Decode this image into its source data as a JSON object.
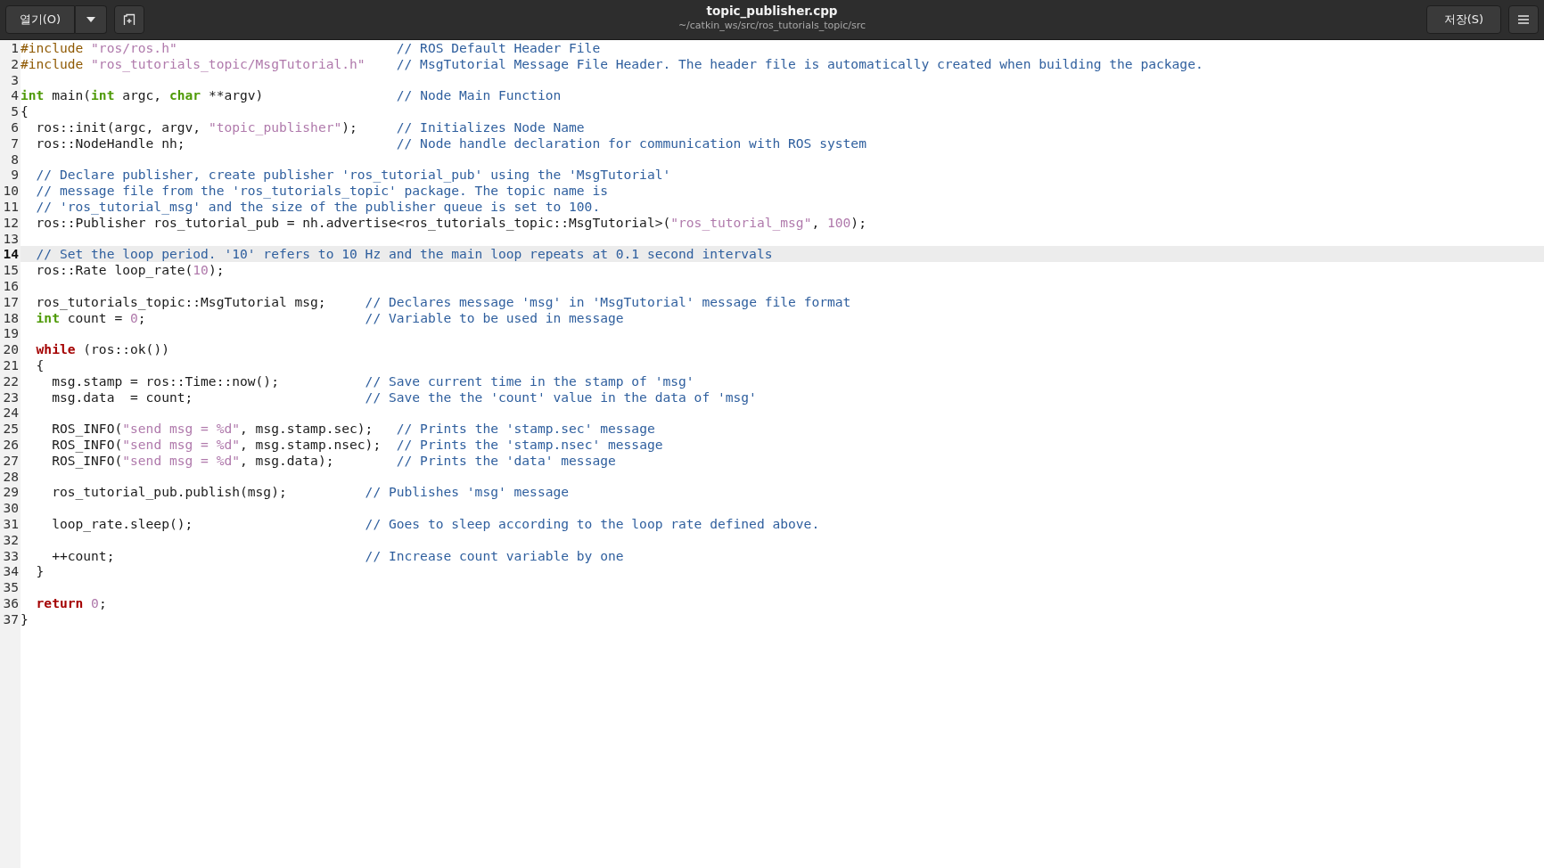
{
  "header": {
    "open_button": "열기(O)",
    "title": "topic_publisher.cpp",
    "subtitle": "~/catkin_ws/src/ros_tutorials_topic/src",
    "save_button": "저장(S)"
  },
  "editor": {
    "lines": [
      {
        "number": "1",
        "current": false,
        "tokens": [
          {
            "kind": "preproc",
            "text": "#include "
          },
          {
            "kind": "string",
            "text": "\"ros/ros.h\""
          },
          {
            "kind": "comment",
            "text": "                            // ROS Default Header File"
          }
        ]
      },
      {
        "number": "2",
        "current": false,
        "tokens": [
          {
            "kind": "preproc",
            "text": "#include "
          },
          {
            "kind": "string",
            "text": "\"ros_tutorials_topic/MsgTutorial.h\""
          },
          {
            "kind": "comment",
            "text": "    // MsgTutorial Message File Header. The header file is automatically created when building the package."
          }
        ]
      },
      {
        "number": "3",
        "current": false
      },
      {
        "number": "4",
        "current": false,
        "tokens": [
          {
            "kind": "type",
            "text": "int"
          },
          {
            "kind": "plain",
            "text": " main("
          },
          {
            "kind": "type",
            "text": "int"
          },
          {
            "kind": "plain",
            "text": " argc, "
          },
          {
            "kind": "type",
            "text": "char"
          },
          {
            "kind": "plain",
            "text": " **argv)"
          },
          {
            "kind": "comment",
            "text": "                 // Node Main Function"
          }
        ]
      },
      {
        "number": "5",
        "current": false,
        "tokens": [
          {
            "kind": "plain",
            "text": "{"
          }
        ]
      },
      {
        "number": "6",
        "current": false,
        "tokens": [
          {
            "kind": "plain",
            "text": "  ros::init(argc, argv, "
          },
          {
            "kind": "string",
            "text": "\"topic_publisher\""
          },
          {
            "kind": "plain",
            "text": ");"
          },
          {
            "kind": "comment",
            "text": "     // Initializes Node Name"
          }
        ]
      },
      {
        "number": "7",
        "current": false,
        "tokens": [
          {
            "kind": "plain",
            "text": "  ros::NodeHandle nh;"
          },
          {
            "kind": "comment",
            "text": "                           // Node handle declaration for communication with ROS system"
          }
        ]
      },
      {
        "number": "8",
        "current": false
      },
      {
        "number": "9",
        "current": false,
        "tokens": [
          {
            "kind": "comment",
            "text": "  // Declare publisher, create publisher 'ros_tutorial_pub' using the 'MsgTutorial'"
          }
        ]
      },
      {
        "number": "10",
        "current": false,
        "tokens": [
          {
            "kind": "comment",
            "text": "  // message file from the 'ros_tutorials_topic' package. The topic name is"
          }
        ]
      },
      {
        "number": "11",
        "current": false,
        "tokens": [
          {
            "kind": "comment",
            "text": "  // 'ros_tutorial_msg' and the size of the publisher queue is set to 100."
          }
        ]
      },
      {
        "number": "12",
        "current": false,
        "tokens": [
          {
            "kind": "plain",
            "text": "  ros::Publisher ros_tutorial_pub = nh.advertise<ros_tutorials_topic::MsgTutorial>("
          },
          {
            "kind": "string",
            "text": "\"ros_tutorial_msg\""
          },
          {
            "kind": "plain",
            "text": ", "
          },
          {
            "kind": "number",
            "text": "100"
          },
          {
            "kind": "plain",
            "text": ");"
          }
        ]
      },
      {
        "number": "13",
        "current": false
      },
      {
        "number": "14",
        "current": true,
        "tokens": [
          {
            "kind": "comment",
            "text": "  // Set the loop period. '10' refers to 10 Hz and the main loop repeats at 0.1 second intervals"
          }
        ]
      },
      {
        "number": "15",
        "current": false,
        "tokens": [
          {
            "kind": "plain",
            "text": "  ros::Rate loop_rate("
          },
          {
            "kind": "number",
            "text": "10"
          },
          {
            "kind": "plain",
            "text": ");"
          }
        ]
      },
      {
        "number": "16",
        "current": false
      },
      {
        "number": "17",
        "current": false,
        "tokens": [
          {
            "kind": "plain",
            "text": "  ros_tutorials_topic::MsgTutorial msg;"
          },
          {
            "kind": "comment",
            "text": "     // Declares message 'msg' in 'MsgTutorial' message file format"
          }
        ]
      },
      {
        "number": "18",
        "current": false,
        "tokens": [
          {
            "kind": "type",
            "text": "  int"
          },
          {
            "kind": "plain",
            "text": " count = "
          },
          {
            "kind": "number",
            "text": "0"
          },
          {
            "kind": "plain",
            "text": ";"
          },
          {
            "kind": "comment",
            "text": "                            // Variable to be used in message"
          }
        ]
      },
      {
        "number": "19",
        "current": false
      },
      {
        "number": "20",
        "current": false,
        "tokens": [
          {
            "kind": "keyword",
            "text": "  while"
          },
          {
            "kind": "plain",
            "text": " (ros::ok())"
          }
        ]
      },
      {
        "number": "21",
        "current": false,
        "tokens": [
          {
            "kind": "plain",
            "text": "  {"
          }
        ]
      },
      {
        "number": "22",
        "current": false,
        "tokens": [
          {
            "kind": "plain",
            "text": "    msg.stamp = ros::Time::now();"
          },
          {
            "kind": "comment",
            "text": "           // Save current time in the stamp of 'msg'"
          }
        ]
      },
      {
        "number": "23",
        "current": false,
        "tokens": [
          {
            "kind": "plain",
            "text": "    msg.data  = count;"
          },
          {
            "kind": "comment",
            "text": "                      // Save the the 'count' value in the data of 'msg'"
          }
        ]
      },
      {
        "number": "24",
        "current": false
      },
      {
        "number": "25",
        "current": false,
        "tokens": [
          {
            "kind": "plain",
            "text": "    ROS_INFO("
          },
          {
            "kind": "string",
            "text": "\"send msg = %d\""
          },
          {
            "kind": "plain",
            "text": ", msg.stamp.sec);"
          },
          {
            "kind": "comment",
            "text": "   // Prints the 'stamp.sec' message"
          }
        ]
      },
      {
        "number": "26",
        "current": false,
        "tokens": [
          {
            "kind": "plain",
            "text": "    ROS_INFO("
          },
          {
            "kind": "string",
            "text": "\"send msg = %d\""
          },
          {
            "kind": "plain",
            "text": ", msg.stamp.nsec);"
          },
          {
            "kind": "comment",
            "text": "  // Prints the 'stamp.nsec' message"
          }
        ]
      },
      {
        "number": "27",
        "current": false,
        "tokens": [
          {
            "kind": "plain",
            "text": "    ROS_INFO("
          },
          {
            "kind": "string",
            "text": "\"send msg = %d\""
          },
          {
            "kind": "plain",
            "text": ", msg.data);"
          },
          {
            "kind": "comment",
            "text": "        // Prints the 'data' message"
          }
        ]
      },
      {
        "number": "28",
        "current": false
      },
      {
        "number": "29",
        "current": false,
        "tokens": [
          {
            "kind": "plain",
            "text": "    ros_tutorial_pub.publish(msg);"
          },
          {
            "kind": "comment",
            "text": "          // Publishes 'msg' message"
          }
        ]
      },
      {
        "number": "30",
        "current": false
      },
      {
        "number": "31",
        "current": false,
        "tokens": [
          {
            "kind": "plain",
            "text": "    loop_rate.sleep();"
          },
          {
            "kind": "comment",
            "text": "                      // Goes to sleep according to the loop rate defined above."
          }
        ]
      },
      {
        "number": "32",
        "current": false
      },
      {
        "number": "33",
        "current": false,
        "tokens": [
          {
            "kind": "plain",
            "text": "    ++count;"
          },
          {
            "kind": "comment",
            "text": "                                // Increase count variable by one"
          }
        ]
      },
      {
        "number": "34",
        "current": false,
        "tokens": [
          {
            "kind": "plain",
            "text": "  }"
          }
        ]
      },
      {
        "number": "35",
        "current": false
      },
      {
        "number": "36",
        "current": false,
        "tokens": [
          {
            "kind": "keyword",
            "text": "  return"
          },
          {
            "kind": "number",
            "text": " 0"
          },
          {
            "kind": "plain",
            "text": ";"
          }
        ]
      },
      {
        "number": "37",
        "current": false,
        "tokens": [
          {
            "kind": "plain",
            "text": "}"
          }
        ]
      }
    ]
  }
}
